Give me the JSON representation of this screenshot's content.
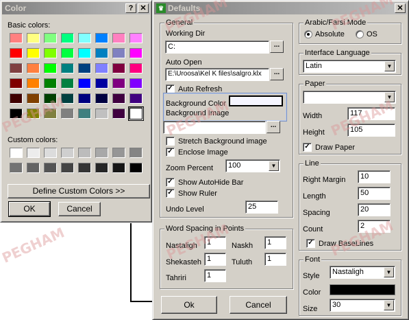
{
  "color_dialog": {
    "title": "Color",
    "help_btn": "?",
    "close_btn": "✕",
    "basic_colors_label": "Basic colors:",
    "custom_colors_label": "Custom colors:",
    "define_button": "Define Custom Colors >>",
    "ok_button": "OK",
    "cancel_button": "Cancel",
    "basic_colors": [
      "#ff8080",
      "#ffff80",
      "#80ff80",
      "#00ff80",
      "#80ffff",
      "#0080ff",
      "#ff80c0",
      "#ff80ff",
      "#ff0000",
      "#ffff00",
      "#80ff00",
      "#00ff40",
      "#00ffff",
      "#0080c0",
      "#8080c0",
      "#ff00ff",
      "#804040",
      "#ff8040",
      "#00ff00",
      "#008080",
      "#004080",
      "#8080ff",
      "#800040",
      "#ff0080",
      "#800000",
      "#ff8000",
      "#008000",
      "#008040",
      "#0000ff",
      "#0000a0",
      "#800080",
      "#8000ff",
      "#400000",
      "#804000",
      "#004000",
      "#004040",
      "#000080",
      "#000040",
      "#400040",
      "#400080",
      "#000000",
      "#808000",
      "#808040",
      "#808080",
      "#408080",
      "#c0c0c0",
      "#400040",
      "#ffffff"
    ],
    "custom_colors": [
      "#ffffff",
      "#ececec",
      "#dcdcdc",
      "#cfcfcf",
      "#bcbcbc",
      "#a8a8a8",
      "#969696",
      "#858585",
      "#737373",
      "#636363",
      "#545454",
      "#444444",
      "#353535",
      "#262626",
      "#161616",
      "#000000"
    ]
  },
  "defaults_dialog": {
    "title": "Defaults",
    "close_btn": "✕",
    "general": {
      "legend": "General",
      "working_dir_label": "Working Dir",
      "working_dir_value": "C:",
      "auto_open_label": "Auto Open",
      "auto_open_value": "E:\\Uroosa\\Kel K files\\salgro.klx",
      "auto_refresh_label": "Auto Refresh",
      "bg_color_label": "Background Color",
      "bg_image_label": "Background Image",
      "stretch_label": "Stretch Background image",
      "enclose_label": "Enclose Image",
      "zoom_label": "Zoom Percent",
      "zoom_value": "100",
      "autohide_label": "Show AutoHide Bar",
      "ruler_label": "Show Ruler",
      "undo_label": "Undo Level",
      "undo_value": "25",
      "ellipsis": "..."
    },
    "word_spacing": {
      "legend": "Word Spacing in Points",
      "nastaligh_label": "Nastaligh",
      "nastaligh_value": "1",
      "naskh_label": "Naskh",
      "naskh_value": "1",
      "shekasteh_label": "Shekasteh",
      "shekasteh_value": "1",
      "tuluth_label": "Tuluth",
      "tuluth_value": "1",
      "tahriri_label": "Tahriri",
      "tahriri_value": "1"
    },
    "ok_button": "Ok",
    "cancel_button": "Cancel",
    "arabic_mode": {
      "legend": "Arabic/Farsi Mode",
      "absolute_label": "Absolute",
      "os_label": "OS"
    },
    "language": {
      "legend": "Interface Language",
      "value": "Latin"
    },
    "paper": {
      "legend": "Paper",
      "width_label": "Width",
      "width_value": "117",
      "height_label": "Height",
      "height_value": "105",
      "draw_paper_label": "Draw Paper"
    },
    "line": {
      "legend": "Line",
      "right_margin_label": "Right Margin",
      "right_margin_value": "10",
      "length_label": "Length",
      "length_value": "50",
      "spacing_label": "Spacing",
      "spacing_value": "20",
      "count_label": "Count",
      "count_value": "2",
      "draw_baselines_label": "Draw BaseLines"
    },
    "font": {
      "legend": "Font",
      "style_label": "Style",
      "style_value": "Nastaligh",
      "color_label": "Color",
      "size_label": "Size",
      "size_value": "30"
    }
  },
  "watermark": "PEGHAM"
}
